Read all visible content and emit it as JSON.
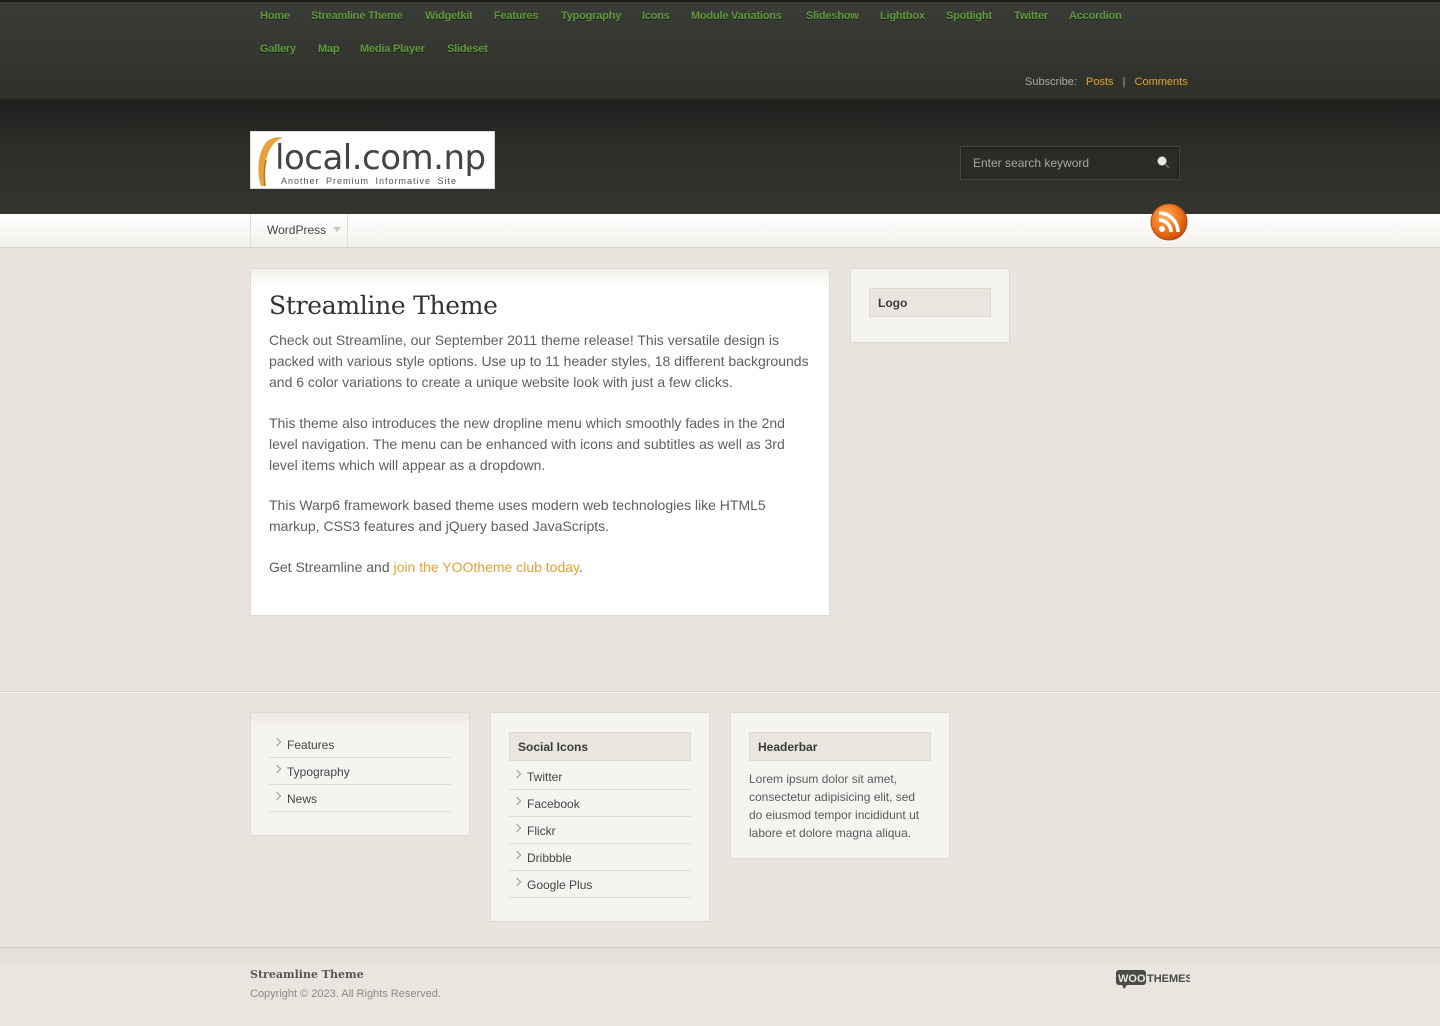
{
  "topnav": {
    "row1": [
      "Home",
      "Streamline Theme",
      "Widgetkit",
      "Features",
      "Typography",
      "Icons",
      "Module Variations",
      "Slideshow",
      "Lightbox",
      "Spotlight",
      "Twitter",
      "Accordion"
    ],
    "row2": [
      "Gallery",
      "Map",
      "Media Player",
      "Slideset"
    ]
  },
  "subscribe": {
    "label": "Subscribe:",
    "posts": "Posts",
    "separator": "|",
    "comments": "Comments"
  },
  "logo": {
    "brand": "local.com.np",
    "tagline": "Another Premium Informative Site"
  },
  "search": {
    "placeholder": "Enter search keyword",
    "icon": "search-icon"
  },
  "menu": {
    "item": "WordPress",
    "icon": "chevron-down-icon"
  },
  "rss": {
    "icon": "rss-icon"
  },
  "article": {
    "title": "Streamline Theme",
    "p1": "Check out Streamline, our September 2011 theme release! This versatile design is packed with various style options. Use up to 11 header styles, 18 different backgrounds and 6 color variations to create a unique website look with just a few clicks.",
    "p2": "This theme also introduces the new dropline menu which smoothly fades in the 2nd level navigation. The menu can be enhanced with icons and subtitles as well as 3rd level items which will appear as a dropdown.",
    "p3": "This Warp6 framework based theme uses modern web technologies like HTML5 markup, CSS3 features and jQuery based JavaScripts.",
    "p4_prefix": "Get Streamline and ",
    "p4_link": "join the YOOtheme club today",
    "p4_suffix": "."
  },
  "sidebar": {
    "title": "Logo"
  },
  "footer_modules": {
    "links": [
      "Features",
      "Typography",
      "News"
    ],
    "social": {
      "title": "Social Icons",
      "items": [
        "Twitter",
        "Facebook",
        "Flickr",
        "Dribbble",
        "Google Plus"
      ]
    },
    "headerbar": {
      "title": "Headerbar",
      "text": "Lorem ipsum dolor sit amet, consectetur adipisicing elit, sed do eiusmod tempor incididunt ut labore et dolore magna aliqua."
    }
  },
  "footer": {
    "site_name": "Streamline Theme",
    "copyright": "Copyright © 2023. All Rights Reserved.",
    "badge": "WOOTHEMES",
    "badge_icon": "woothemes-logo"
  },
  "colors": {
    "accent": "#e4a12d",
    "topnav_link": "#5e9a3b",
    "topbar_bg": "#383934"
  }
}
